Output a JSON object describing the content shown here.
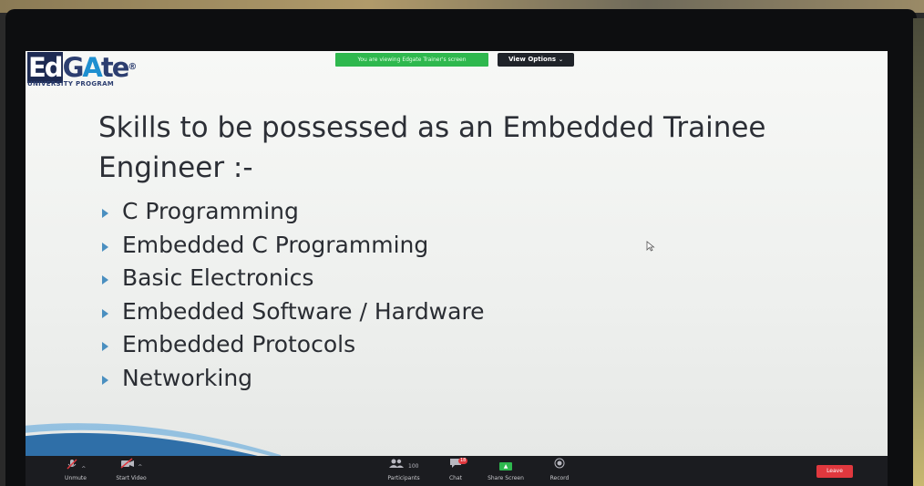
{
  "logo": {
    "mark_pre": "Ed",
    "mark_mid": "G",
    "mark_a": "A",
    "mark_post": "te",
    "registered": "®",
    "subtitle": "UNIVERSITY PROGRAM"
  },
  "share_banner": {
    "text": "You are viewing Edgate Trainer's screen"
  },
  "view_options": {
    "label": "View Options",
    "caret": "⌄"
  },
  "slide": {
    "title": "Skills to be possessed as an Embedded Trainee Engineer :-",
    "bullets": [
      "C Programming",
      "Embedded C Programming",
      "Basic Electronics",
      "Embedded Software / Hardware",
      "Embedded Protocols",
      "Networking"
    ]
  },
  "toolbar": {
    "unmute": {
      "label": "Unmute",
      "icon": "microphone-muted-icon"
    },
    "start_video": {
      "label": "Start Video",
      "icon": "video-off-icon"
    },
    "participants": {
      "label": "Participants",
      "count": "100",
      "icon": "participants-icon"
    },
    "chat": {
      "label": "Chat",
      "badge": "18",
      "icon": "chat-icon"
    },
    "share_screen": {
      "label": "Share Screen",
      "icon": "share-screen-icon"
    },
    "record": {
      "label": "Record",
      "icon": "record-icon"
    },
    "leave": {
      "label": "Leave"
    }
  },
  "colors": {
    "banner_green": "#2eb84e",
    "leave_red": "#e0383e",
    "bullet_blue": "#4a8fc0",
    "toolbar_bg": "#1b1c20"
  }
}
